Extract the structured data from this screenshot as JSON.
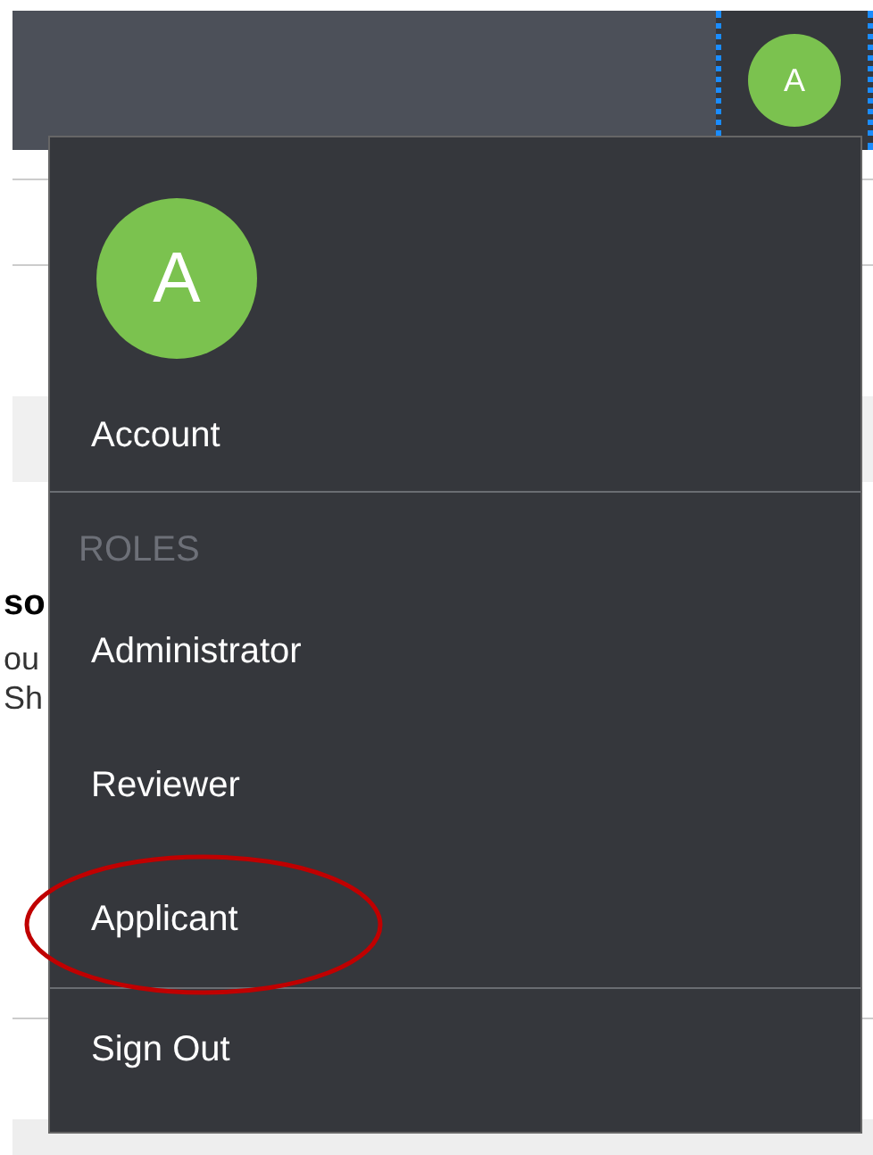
{
  "header": {
    "avatar_initial": "A"
  },
  "background": {
    "heading_fragment": "so",
    "text_fragments": [
      "ou",
      "Sh"
    ]
  },
  "menu": {
    "avatar_initial": "A",
    "account": "Account",
    "roles_heading": "ROLES",
    "roles": [
      {
        "label": "Administrator",
        "highlighted": false
      },
      {
        "label": "Reviewer",
        "highlighted": false
      },
      {
        "label": "Applicant",
        "highlighted": true
      }
    ],
    "sign_out": "Sign Out"
  }
}
